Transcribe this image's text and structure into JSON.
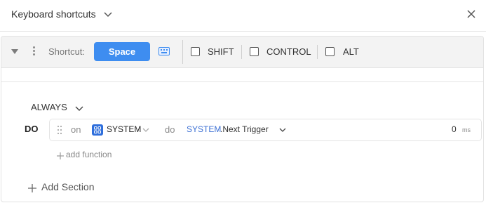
{
  "header": {
    "title": "Keyboard shortcuts"
  },
  "shortcut": {
    "label": "Shortcut:",
    "key": "Space",
    "modifiers": [
      {
        "label": "SHIFT",
        "checked": false
      },
      {
        "label": "CONTROL",
        "checked": false
      },
      {
        "label": "ALT",
        "checked": false
      }
    ]
  },
  "section": {
    "condition": "ALWAYS",
    "do_label": "DO",
    "action": {
      "on_label": "on",
      "target": "SYSTEM",
      "do_word": "do",
      "function_namespace": "SYSTEM",
      "function_name": ".Next Trigger",
      "delay_value": "0",
      "delay_unit": "ms"
    },
    "add_function": "add function"
  },
  "add_section": "Add Section",
  "colors": {
    "accent": "#3e8df0",
    "system_icon": "#2f6fdc",
    "namespace_text": "#3b6fd4"
  }
}
